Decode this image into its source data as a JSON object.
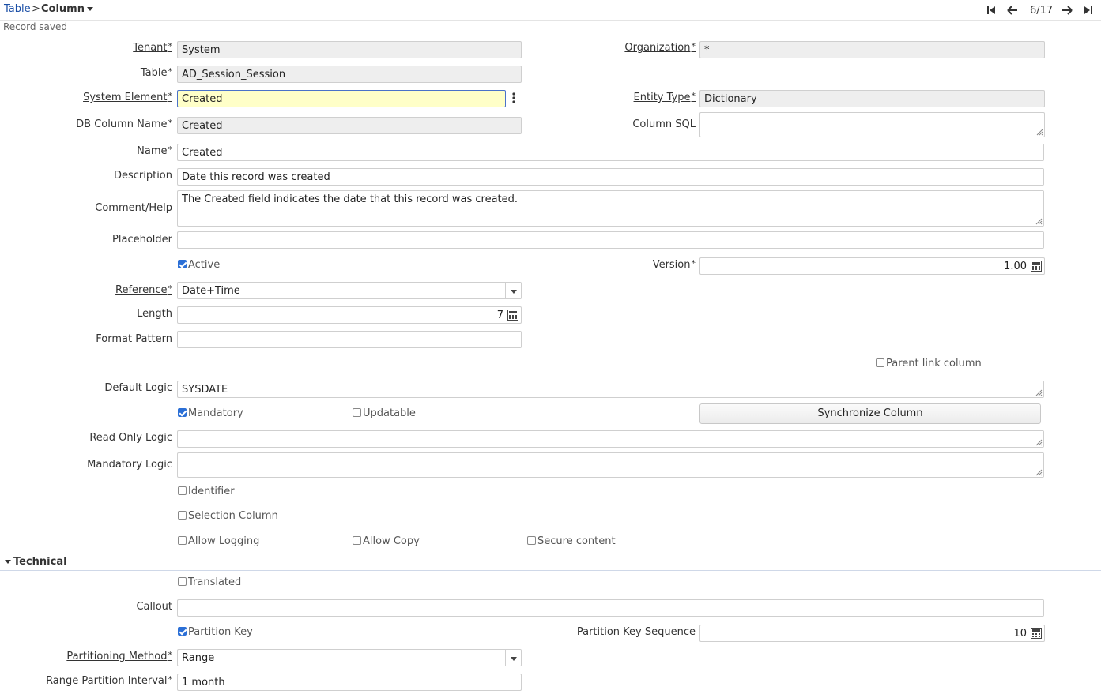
{
  "breadcrumb": {
    "parent": "Table",
    "separator": ">",
    "current": "Column"
  },
  "nav": {
    "page_indicator": "6/17"
  },
  "status": "Record saved",
  "fields": {
    "tenant": {
      "label": "Tenant",
      "value": "System"
    },
    "organization": {
      "label": "Organization",
      "value": "*"
    },
    "table": {
      "label": "Table",
      "value": "AD_Session_Session"
    },
    "system_element": {
      "label": "System Element",
      "value": "Created"
    },
    "entity_type": {
      "label": "Entity Type",
      "value": "Dictionary"
    },
    "db_column_name": {
      "label": "DB Column Name",
      "value": "Created"
    },
    "column_sql": {
      "label": "Column SQL",
      "value": ""
    },
    "name": {
      "label": "Name",
      "value": "Created"
    },
    "description": {
      "label": "Description",
      "value": "Date this record was created"
    },
    "comment_help": {
      "label": "Comment/Help",
      "value": "The Created field indicates the date that this record was created."
    },
    "placeholder": {
      "label": "Placeholder",
      "value": ""
    },
    "active": {
      "label": "Active",
      "checked": true
    },
    "version": {
      "label": "Version",
      "value": "1.00"
    },
    "reference": {
      "label": "Reference",
      "value": "Date+Time"
    },
    "length": {
      "label": "Length",
      "value": "7"
    },
    "format_pattern": {
      "label": "Format Pattern",
      "value": ""
    },
    "parent_link_column": {
      "label": "Parent link column",
      "checked": false
    },
    "default_logic": {
      "label": "Default Logic",
      "value": "SYSDATE"
    },
    "mandatory": {
      "label": "Mandatory",
      "checked": true
    },
    "updatable": {
      "label": "Updatable",
      "checked": false
    },
    "synchronize_column": {
      "label": "Synchronize Column"
    },
    "read_only_logic": {
      "label": "Read Only Logic",
      "value": ""
    },
    "mandatory_logic": {
      "label": "Mandatory Logic",
      "value": ""
    },
    "identifier": {
      "label": "Identifier",
      "checked": false
    },
    "selection_column": {
      "label": "Selection Column",
      "checked": false
    },
    "allow_logging": {
      "label": "Allow Logging",
      "checked": false
    },
    "allow_copy": {
      "label": "Allow Copy",
      "checked": false
    },
    "secure_content": {
      "label": "Secure content",
      "checked": false
    }
  },
  "technical": {
    "title": "Technical",
    "translated": {
      "label": "Translated",
      "checked": false
    },
    "callout": {
      "label": "Callout",
      "value": ""
    },
    "partition_key": {
      "label": "Partition Key",
      "checked": true
    },
    "partition_key_sequence": {
      "label": "Partition Key Sequence",
      "value": "10"
    },
    "partitioning_method": {
      "label": "Partitioning Method",
      "value": "Range"
    },
    "range_partition_interval": {
      "label": "Range Partition Interval",
      "value": "1 month"
    }
  },
  "required_marker": "*",
  "colors": {
    "link": "#1a4ea6",
    "focus_bg": "#ffffc8",
    "readonly_bg": "#eeeeee",
    "check_on": "#2b6fd6"
  }
}
